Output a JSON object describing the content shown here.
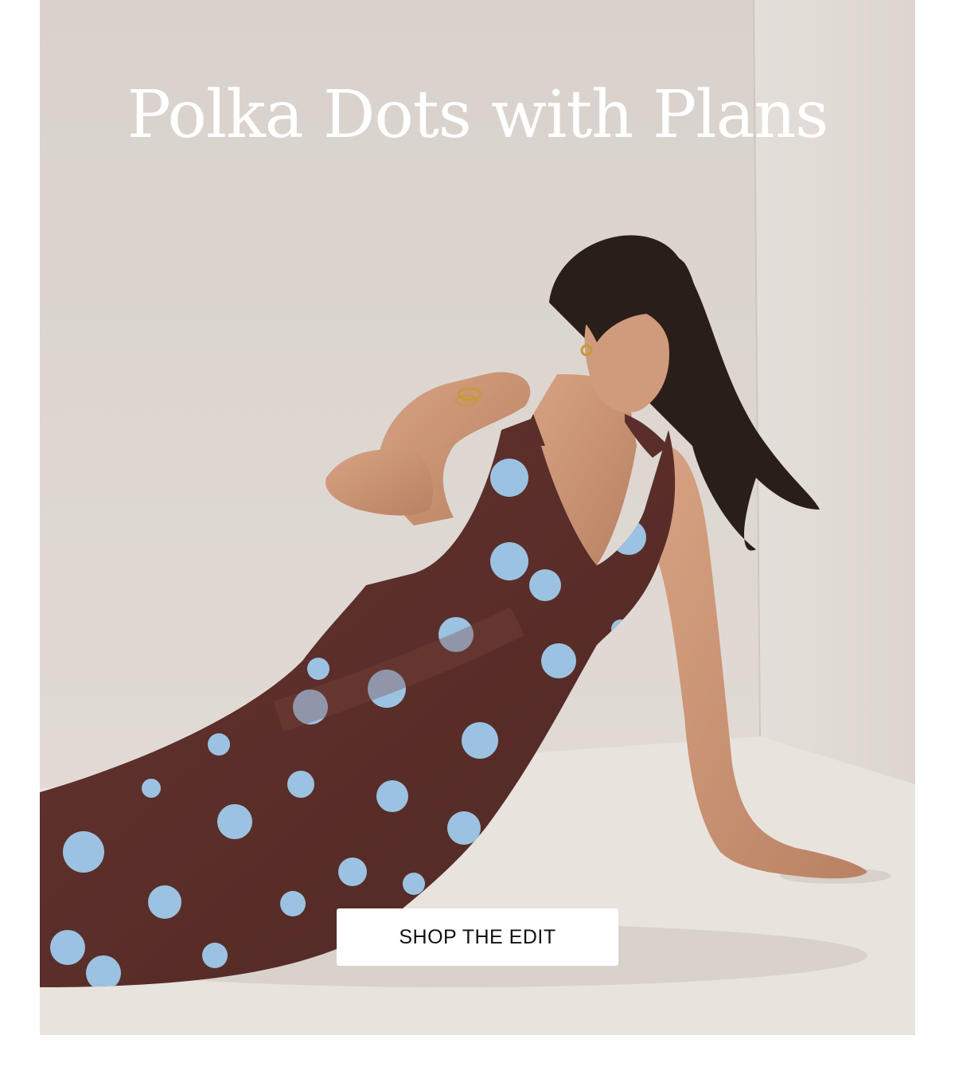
{
  "hero": {
    "headline": "Polka Dots with Plans",
    "image_alt": "Model in a brown halter maxi dress with light blue polka dots reclining on the floor",
    "cta_label": "SHOP THE EDIT"
  },
  "colors": {
    "backdrop": "#d8d1cb",
    "floor": "#e8e2dc",
    "dress": "#5a2e2a",
    "dots": "#9cc2e2",
    "skin": "#c99373",
    "hair": "#2a1e18",
    "headline_text": "#ffffff",
    "button_bg": "#ffffff",
    "button_text": "#111111"
  }
}
